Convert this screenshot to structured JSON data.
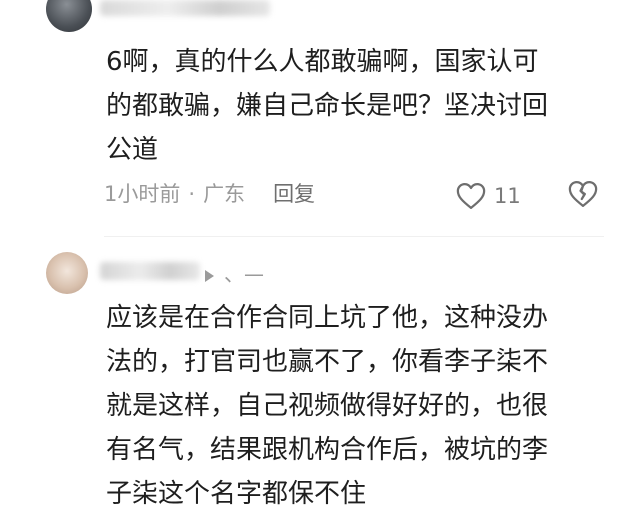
{
  "comments": [
    {
      "text": "6啊，真的什么人都敢骗啊，国家认可\n的都敢骗，嫌自己命长是吧？坚决讨回\n公道",
      "time": "1小时前",
      "separator": "·",
      "location": "广东",
      "reply_label": "回复",
      "like_count": "11",
      "icons": {
        "like": "heart-icon",
        "dislike": "broken-heart-icon"
      }
    },
    {
      "name_suffix": "、—",
      "text": "应该是在合作合同上坑了他，这种没办\n法的，打官司也赢不了，你看李子柒不\n就是这样，自己视频做得好好的，也很\n有名气，结果跟机构合作后，被坑的李\n子柒这个名字都保不住"
    }
  ]
}
